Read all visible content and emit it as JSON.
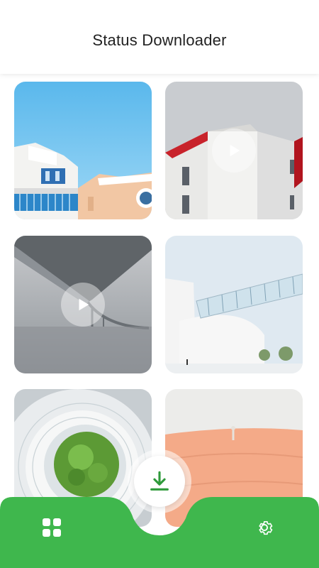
{
  "app": {
    "title": "Status Downloader"
  },
  "colors": {
    "accent": "#3fb74d",
    "accent_dark": "#2f9a3b",
    "header_bg": "#ffffff",
    "title_text": "#222222"
  },
  "media": [
    {
      "name": "buildings-blue-sky",
      "type": "image"
    },
    {
      "name": "white-red-building",
      "type": "video"
    },
    {
      "name": "bridge-fog",
      "type": "video"
    },
    {
      "name": "glass-walkway",
      "type": "image"
    },
    {
      "name": "spiral-staircase",
      "type": "image"
    },
    {
      "name": "desert-dunes",
      "type": "image"
    }
  ],
  "bottom_nav": {
    "items": [
      {
        "icon": "grid-icon",
        "active": true
      },
      {
        "icon": "download-icon",
        "active": false
      },
      {
        "icon": "gear-icon",
        "active": false
      }
    ]
  }
}
